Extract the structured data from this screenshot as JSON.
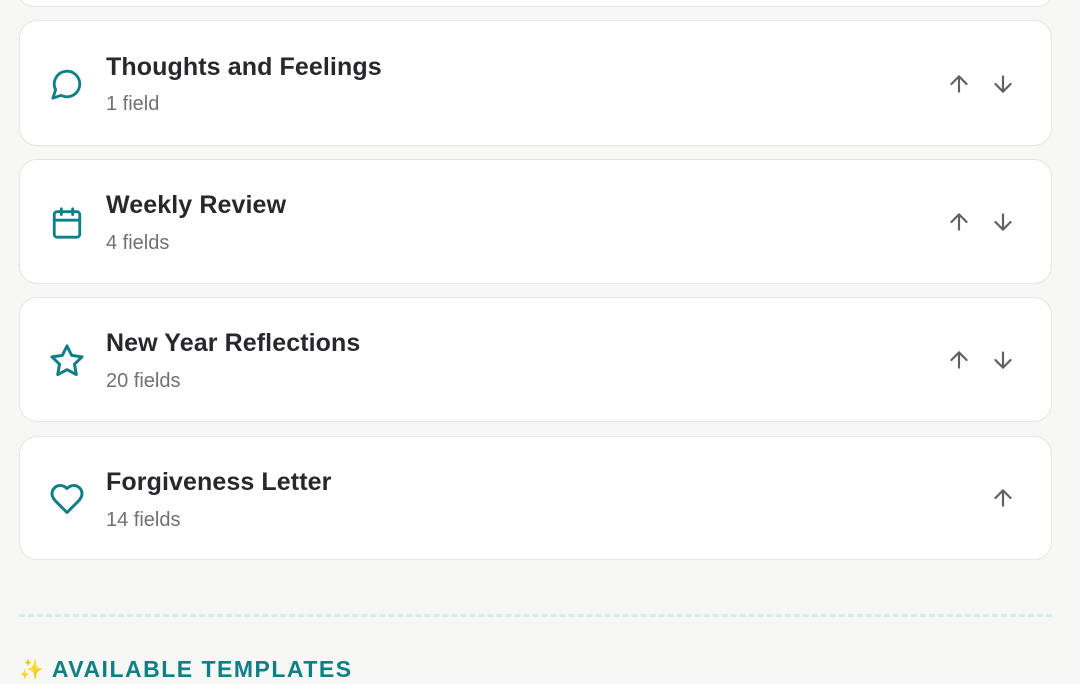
{
  "colors": {
    "accent": "#0f7f86",
    "page_background": "#f7f7f5",
    "card_background": "#ffffff",
    "title_text": "#26282b",
    "muted_text": "#6f7175",
    "arrow": "#5e6064"
  },
  "templates": [
    {
      "title": "Thoughts and Feelings",
      "field_count": "1 field",
      "icon": "speech-bubble-icon"
    },
    {
      "title": "Weekly Review",
      "field_count": "4 fields",
      "icon": "calendar-icon"
    },
    {
      "title": "New Year Reflections",
      "field_count": "20 fields",
      "icon": "star-icon"
    },
    {
      "title": "Forgiveness Letter",
      "field_count": "14 fields",
      "icon": "heart-icon"
    }
  ],
  "section": {
    "icon": "sparkles-icon",
    "sparkle_glyph": "✨",
    "title": "AVAILABLE TEMPLATES"
  }
}
